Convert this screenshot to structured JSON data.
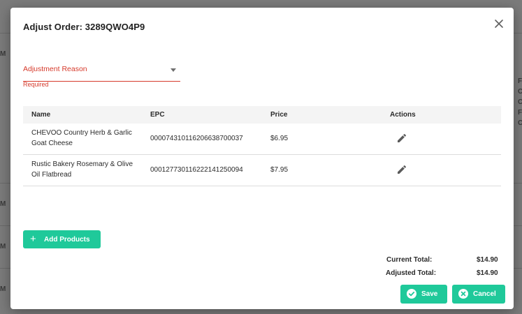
{
  "background": {
    "left_marks": [
      "M",
      "M",
      "M",
      "M"
    ],
    "right_marks": [
      "F",
      "C",
      "C",
      "F",
      "C"
    ]
  },
  "modal": {
    "title": "Adjust Order: 3289QWO4P9",
    "close_icon": "close-icon"
  },
  "reason": {
    "label": "Adjustment Reason",
    "helper": "Required"
  },
  "table": {
    "headers": {
      "name": "Name",
      "epc": "EPC",
      "price": "Price",
      "actions": "Actions"
    },
    "rows": [
      {
        "name": "CHEVOO Country Herb & Garlic Goat Cheese",
        "epc": "000074310116206638700037",
        "price": "$6.95",
        "action_icon": "pencil-icon"
      },
      {
        "name": "Rustic Bakery Rosemary & Olive Oil Flatbread",
        "epc": "000127730116222141250094",
        "price": "$7.95",
        "action_icon": "pencil-icon"
      }
    ]
  },
  "add_products": {
    "icon": "+",
    "label": "Add Products"
  },
  "totals": {
    "current_label": "Current Total:",
    "current_value": "$14.90",
    "adjusted_label": "Adjusted Total:",
    "adjusted_value": "$14.90"
  },
  "buttons": {
    "save_label": "Save",
    "cancel_label": "Cancel"
  },
  "colors": {
    "accent": "#1fc99a",
    "error": "#d63a2b"
  }
}
